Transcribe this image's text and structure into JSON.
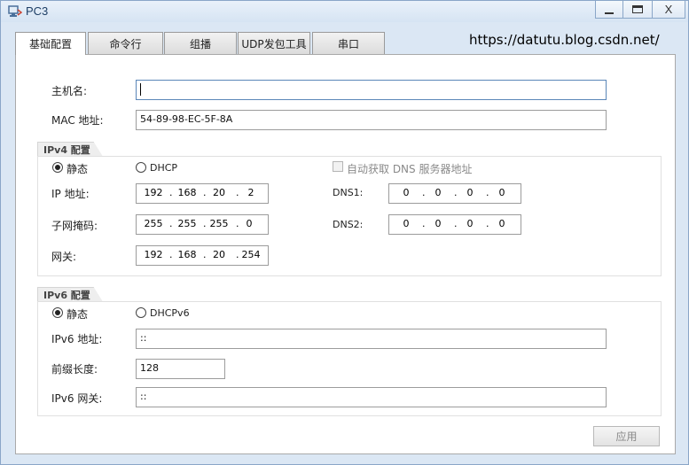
{
  "window": {
    "title": "PC3",
    "minimize": "",
    "maximize": "",
    "close": "X"
  },
  "tabs": [
    {
      "label": "基础配置"
    },
    {
      "label": "命令行"
    },
    {
      "label": "组播"
    },
    {
      "label": "UDP发包工具"
    },
    {
      "label": "串口"
    }
  ],
  "watermark": "https://datutu.blog.csdn.net/",
  "basic": {
    "hostname_label": "主机名:",
    "hostname_value": "",
    "mac_label": "MAC 地址:",
    "mac_value": "54-89-98-EC-5F-8A"
  },
  "ipv4": {
    "group_label": "IPv4 配置",
    "static_label": "静态",
    "dhcp_label": "DHCP",
    "auto_dns_label": "自动获取 DNS 服务器地址",
    "ip_label": "IP 地址:",
    "ip": [
      "192",
      "168",
      "20",
      "2"
    ],
    "mask_label": "子网掩码:",
    "mask": [
      "255",
      "255",
      "255",
      "0"
    ],
    "gateway_label": "网关:",
    "gateway": [
      "192",
      "168",
      "20",
      "254"
    ],
    "dns1_label": "DNS1:",
    "dns1": [
      "0",
      "0",
      "0",
      "0"
    ],
    "dns2_label": "DNS2:",
    "dns2": [
      "0",
      "0",
      "0",
      "0"
    ]
  },
  "ipv6": {
    "group_label": "IPv6 配置",
    "static_label": "静态",
    "dhcp_label": "DHCPv6",
    "address_label": "IPv6 地址:",
    "address_value": "::",
    "prefix_label": "前缀长度:",
    "prefix_value": "128",
    "gateway_label": "IPv6 网关:",
    "gateway_value": "::"
  },
  "apply_label": "应用"
}
